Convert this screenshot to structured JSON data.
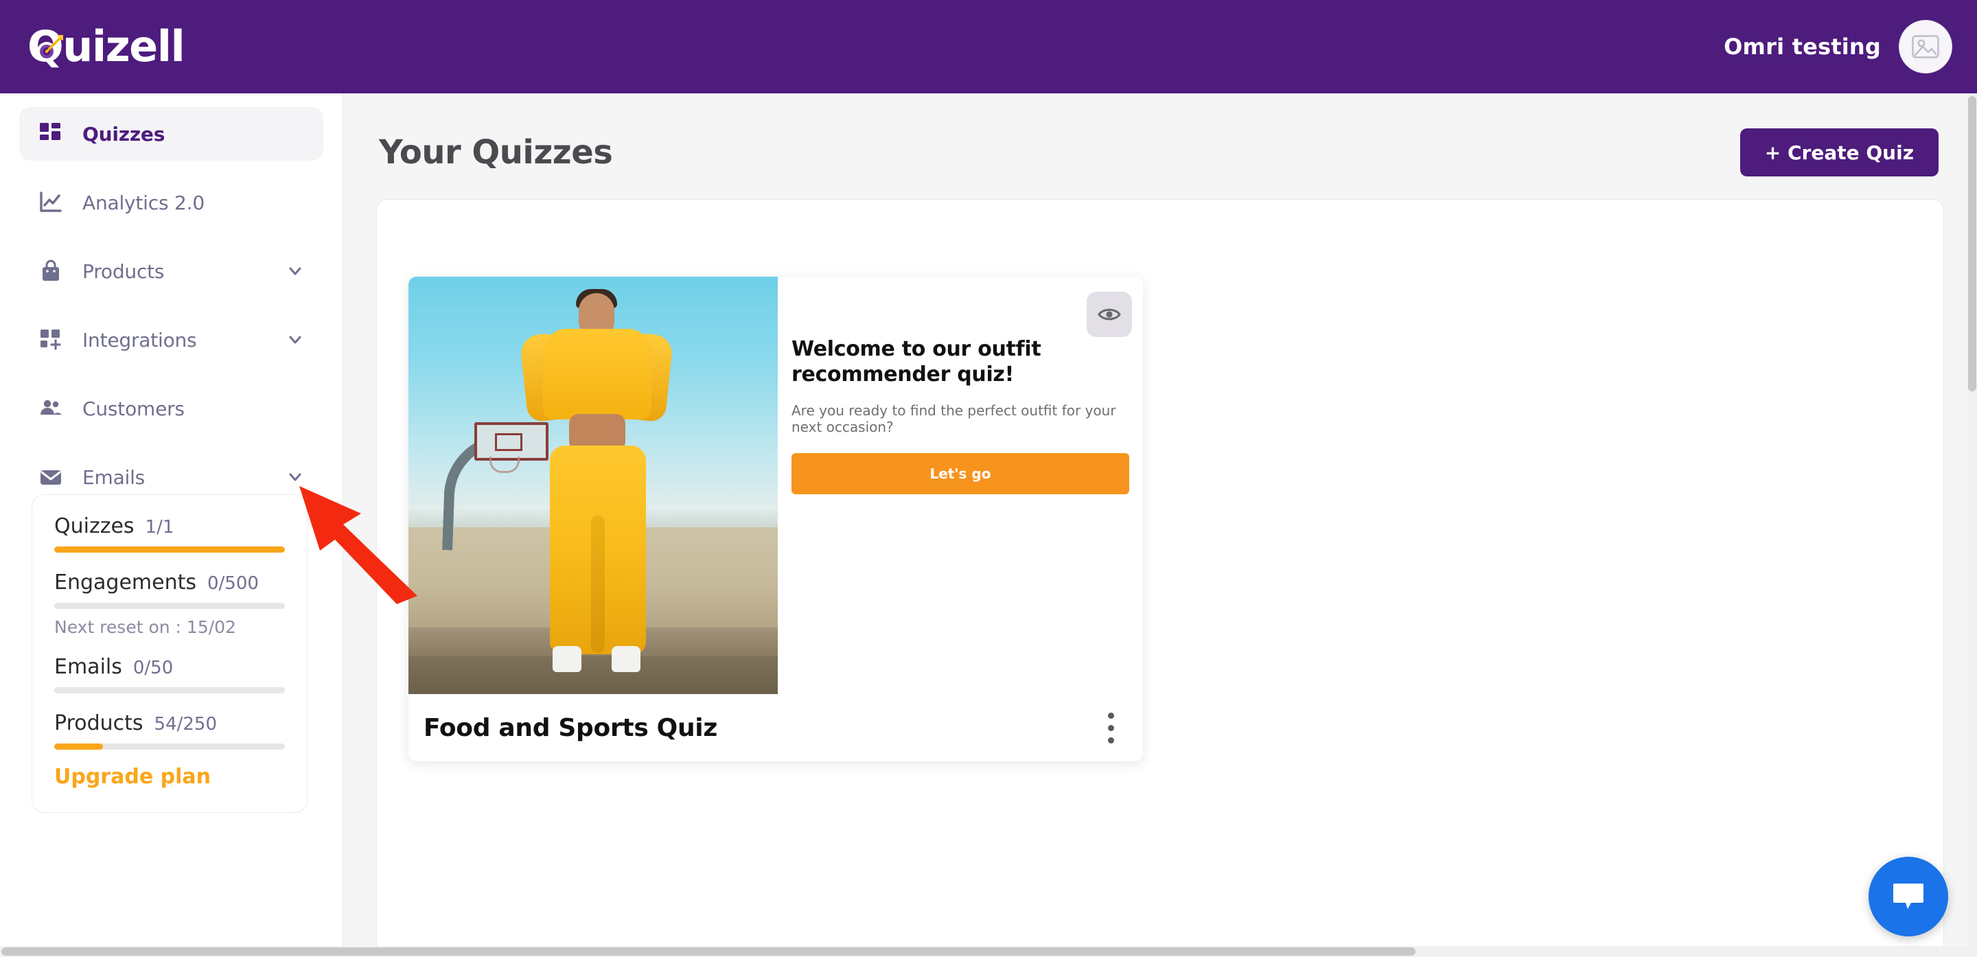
{
  "topbar": {
    "brand_name": "Quizell",
    "brand_icon": "target-dart-icon",
    "user_name": "Omri testing",
    "avatar_icon": "image-placeholder-icon"
  },
  "sidebar": {
    "items": [
      {
        "label": "Quizzes",
        "icon": "dashboard-grid-icon",
        "active": true,
        "chevron": false
      },
      {
        "label": "Analytics 2.0",
        "icon": "line-chart-icon",
        "active": false,
        "chevron": false
      },
      {
        "label": "Products",
        "icon": "shopping-bag-icon",
        "active": false,
        "chevron": true
      },
      {
        "label": "Integrations",
        "icon": "grid-plus-icon",
        "active": false,
        "chevron": true
      },
      {
        "label": "Customers",
        "icon": "people-icon",
        "active": false,
        "chevron": false
      },
      {
        "label": "Emails",
        "icon": "envelope-icon",
        "active": false,
        "chevron": true
      }
    ],
    "usage": {
      "rows": [
        {
          "name": "Quizzes",
          "value": "1/1",
          "percent": 100
        },
        {
          "name": "Engagements",
          "value": "0/500",
          "percent": 0
        },
        {
          "name": "Emails",
          "value": "0/50",
          "percent": 0
        },
        {
          "name": "Products",
          "value": "54/250",
          "percent": 21
        }
      ],
      "reset_note": "Next reset on : 15/02",
      "upgrade_label": "Upgrade plan"
    }
  },
  "main": {
    "page_title": "Your Quizzes",
    "create_button": "+ Create Quiz",
    "quiz_card": {
      "name": "Food and Sports Quiz",
      "preview_title": "Welcome to our outfit recommender quiz!",
      "preview_subtitle": "Are you ready to find the perfect outfit for your next occasion?",
      "preview_cta": "Let's go",
      "eye_icon": "eye-preview-icon",
      "menu_icon": "kebab-menu-icon",
      "thumbnail_alt": "woman-in-yellow-tracksuit-on-basketball-court"
    }
  },
  "chat": {
    "icon": "chat-bubble-icon"
  },
  "annotation": {
    "icon": "red-arrow-pointing-up-left"
  },
  "colors": {
    "brand_purple": "#4d1c7d",
    "accent_orange": "#faa61a",
    "cta_orange": "#f7941d",
    "chat_blue": "#1a73e8",
    "annotation_red": "#f42a10",
    "muted_text": "#6f6f8e",
    "page_bg": "#f5f5f6"
  }
}
